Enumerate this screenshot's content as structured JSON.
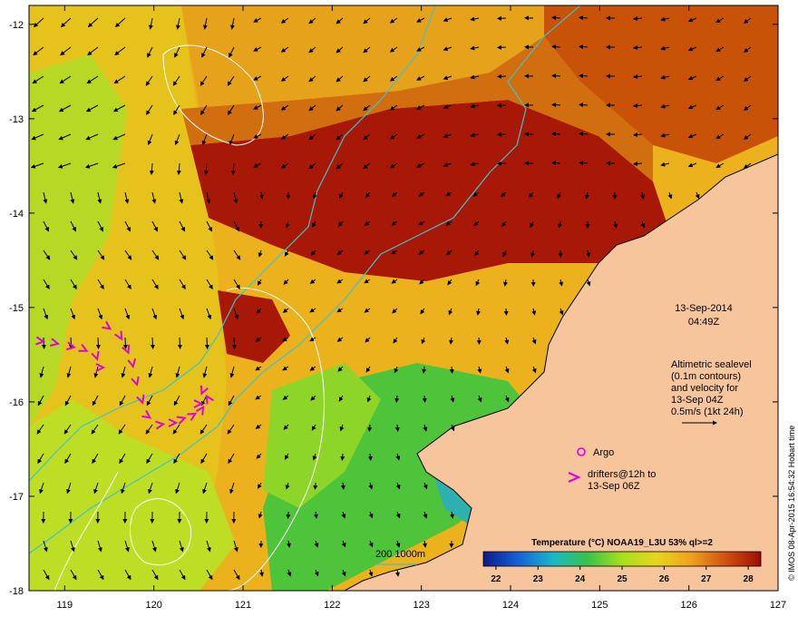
{
  "map": {
    "lon_range": [
      118.6,
      127
    ],
    "lat_range": [
      -18,
      -11.8
    ],
    "lon_ticks": [
      119,
      120,
      121,
      122,
      123,
      124,
      125,
      126,
      127
    ],
    "lat_ticks": [
      -12,
      -13,
      -14,
      -15,
      -16,
      -17,
      -18
    ]
  },
  "labels": {
    "date": "13-Sep-2014",
    "time": "04:49Z",
    "altimetry": [
      "Altimetric sealevel",
      "(0.1m contours)",
      "and velocity for",
      "13-Sep 04Z",
      "0.5m/s (1kt 24h)"
    ],
    "argo": "Argo",
    "drifters": [
      "drifters@12h to",
      "13-Sep 06Z"
    ],
    "depth_contours": "200 1000m",
    "colorbar_title": "Temperature (°C) NOAA19_L3U 53% ql>=2",
    "credit": "© IMOS 08-Apr-2015 16:54:32 Hobart time"
  },
  "colorbar": {
    "ticks": [
      22,
      23,
      24,
      25,
      26,
      27,
      28
    ],
    "range": [
      21.7,
      28.3
    ],
    "stops": [
      "#0a1b8a",
      "#1660d8",
      "#19b8c8",
      "#39c24a",
      "#a8e01c",
      "#e6d61e",
      "#f0a020",
      "#d05010",
      "#9e0d02"
    ]
  },
  "colors": {
    "land": "#f6c59c",
    "depth_contour": "#3ec4c8",
    "sealevel_contour": "#ffffff",
    "argo": "#e000e0",
    "drifter": "#e000e0",
    "vector": "#000000"
  }
}
